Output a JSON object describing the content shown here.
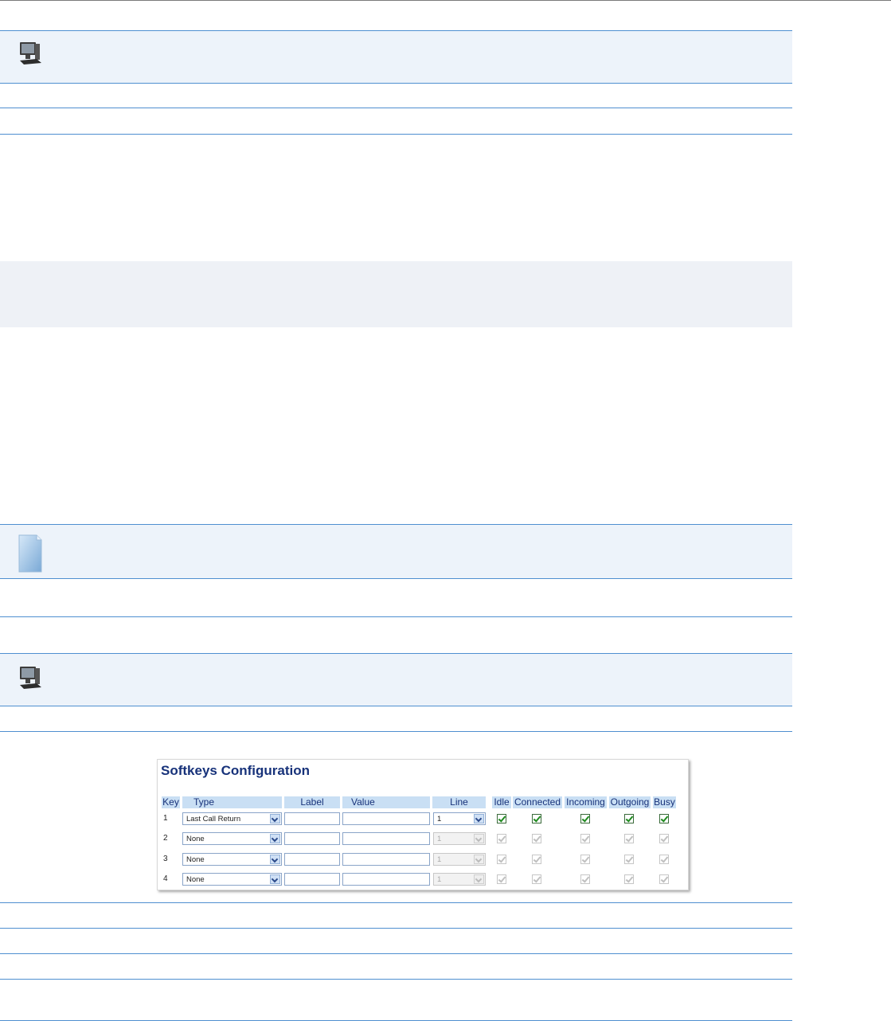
{
  "softkeys": {
    "title": "Softkeys Configuration",
    "headers": {
      "key": "Key",
      "type": "Type",
      "label": "Label",
      "value": "Value",
      "line": "Line",
      "idle": "Idle",
      "connected": "Connected",
      "incoming": "Incoming",
      "outgoing": "Outgoing",
      "busy": "Busy"
    },
    "rows": [
      {
        "key": "1",
        "type": "Last Call Return",
        "label": "",
        "value": "",
        "line": "1",
        "enabled": true,
        "idle": true,
        "connected": true,
        "incoming": true,
        "outgoing": true,
        "busy": true
      },
      {
        "key": "2",
        "type": "None",
        "label": "",
        "value": "",
        "line": "1",
        "enabled": false,
        "idle": true,
        "connected": true,
        "incoming": true,
        "outgoing": true,
        "busy": true
      },
      {
        "key": "3",
        "type": "None",
        "label": "",
        "value": "",
        "line": "1",
        "enabled": false,
        "idle": true,
        "connected": true,
        "incoming": true,
        "outgoing": true,
        "busy": true
      },
      {
        "key": "4",
        "type": "None",
        "label": "",
        "value": "",
        "line": "1",
        "enabled": false,
        "idle": true,
        "connected": true,
        "incoming": true,
        "outgoing": true,
        "busy": true
      }
    ]
  },
  "icons": {
    "monitor_1": "computer-monitor-icon",
    "note": "note-icon",
    "monitor_2": "computer-monitor-icon"
  },
  "colors": {
    "rule": "#4f8fd0",
    "band": "#edf3fa",
    "title": "#17327a",
    "header_bg": "#c9dff4",
    "check": "#1e8a1e"
  }
}
